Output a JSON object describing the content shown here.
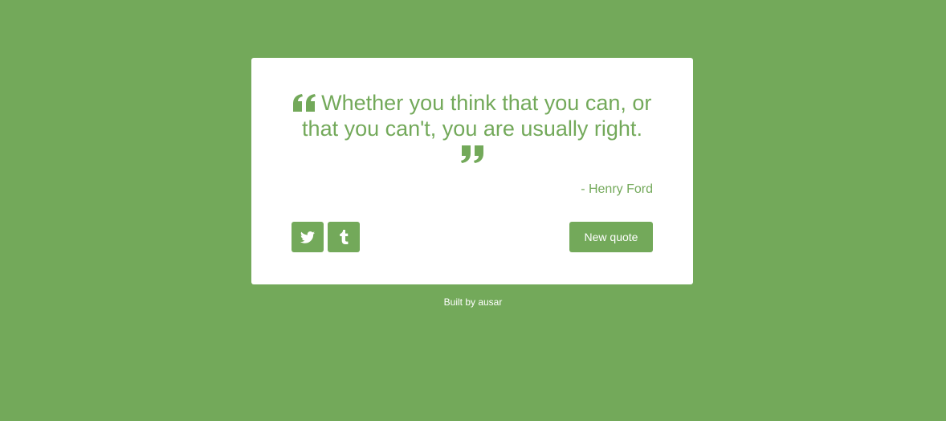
{
  "theme": {
    "accent": "#73a95a",
    "card_bg": "#ffffff"
  },
  "quote": {
    "text": "Whether you think that you can, or that you can't, you are usually right.",
    "author": "- Henry Ford"
  },
  "actions": {
    "twitter_icon": "twitter-icon",
    "tumblr_icon": "tumblr-icon",
    "new_quote_label": "New quote"
  },
  "footer": {
    "text": "Built by ausar"
  }
}
